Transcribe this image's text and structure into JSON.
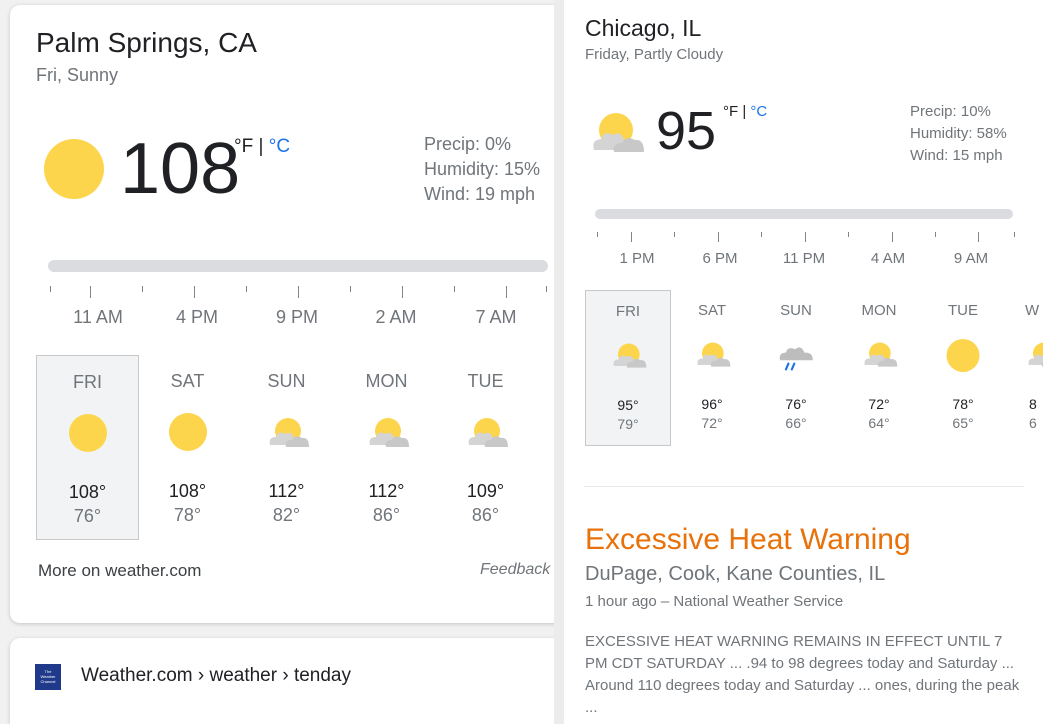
{
  "left": {
    "location": "Palm Springs, CA",
    "condition": "Fri, Sunny",
    "temp": "108",
    "unit_f": "°F",
    "unit_sep": "|",
    "unit_c": "°C",
    "precip": "Precip: 0%",
    "humidity": "Humidity: 15%",
    "wind": "Wind: 19 mph",
    "times": [
      "11 AM",
      "4 PM",
      "9 PM",
      "2 AM",
      "7 AM"
    ],
    "days": [
      {
        "name": "FRI",
        "icon": "sunny-icon",
        "hi": "108°",
        "lo": "76°"
      },
      {
        "name": "SAT",
        "icon": "sunny-icon",
        "hi": "108°",
        "lo": "78°"
      },
      {
        "name": "SUN",
        "icon": "partly-cloudy-icon",
        "hi": "112°",
        "lo": "82°"
      },
      {
        "name": "MON",
        "icon": "partly-cloudy-icon",
        "hi": "112°",
        "lo": "86°"
      },
      {
        "name": "TUE",
        "icon": "partly-cloudy-icon",
        "hi": "109°",
        "lo": "86°"
      }
    ],
    "more_link": "More on weather.com",
    "feedback": "Feedback",
    "result_breadcrumb": "Weather.com › weather › tenday",
    "logo_text": "The Weather Channel"
  },
  "right": {
    "location": "Chicago, IL",
    "condition": "Friday, Partly Cloudy",
    "temp": "95",
    "unit_f": "°F",
    "unit_sep": "|",
    "unit_c": "°C",
    "precip": "Precip: 10%",
    "humidity": "Humidity: 58%",
    "wind": "Wind: 15 mph",
    "times": [
      "1 PM",
      "6 PM",
      "11 PM",
      "4 AM",
      "9 AM"
    ],
    "days": [
      {
        "name": "FRI",
        "icon": "partly-cloudy-icon",
        "hi": "95°",
        "lo": "79°"
      },
      {
        "name": "SAT",
        "icon": "partly-cloudy-icon",
        "hi": "96°",
        "lo": "72°"
      },
      {
        "name": "SUN",
        "icon": "rain-icon",
        "hi": "76°",
        "lo": "66°"
      },
      {
        "name": "MON",
        "icon": "partly-cloudy-icon",
        "hi": "72°",
        "lo": "64°"
      },
      {
        "name": "TUE",
        "icon": "sunny-icon",
        "hi": "78°",
        "lo": "65°"
      },
      {
        "name": "W",
        "icon": "partly-cloudy-icon",
        "hi": "8",
        "lo": "6"
      }
    ],
    "alert_title": "Excessive Heat Warning",
    "alert_area": "DuPage, Cook, Kane Counties, IL",
    "alert_source": "1 hour ago – National Weather Service",
    "alert_text": "EXCESSIVE HEAT WARNING REMAINS IN EFFECT UNTIL 7 PM CDT SATURDAY ... .94 to 98 degrees today and Saturday ... Around 110 degrees today and Saturday ... ones, during the peak ..."
  },
  "colors": {
    "sun": "#fcd54d",
    "cloud": "#d4d4d4",
    "rain": "#1a73e8",
    "warning": "#e8710a",
    "celsius_link": "#1a73e8"
  }
}
